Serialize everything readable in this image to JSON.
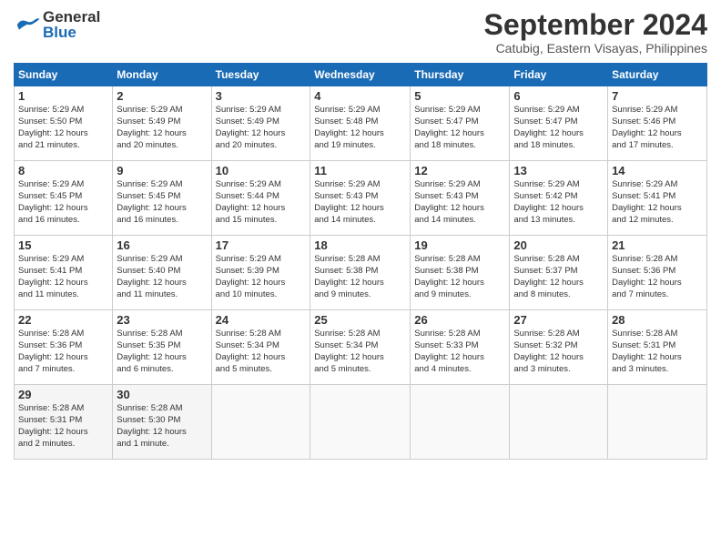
{
  "header": {
    "logo_line1": "General",
    "logo_line2": "Blue",
    "month": "September 2024",
    "location": "Catubig, Eastern Visayas, Philippines"
  },
  "weekdays": [
    "Sunday",
    "Monday",
    "Tuesday",
    "Wednesday",
    "Thursday",
    "Friday",
    "Saturday"
  ],
  "weeks": [
    [
      {
        "day": "1",
        "info": "Sunrise: 5:29 AM\nSunset: 5:50 PM\nDaylight: 12 hours\nand 21 minutes."
      },
      {
        "day": "2",
        "info": "Sunrise: 5:29 AM\nSunset: 5:49 PM\nDaylight: 12 hours\nand 20 minutes."
      },
      {
        "day": "3",
        "info": "Sunrise: 5:29 AM\nSunset: 5:49 PM\nDaylight: 12 hours\nand 20 minutes."
      },
      {
        "day": "4",
        "info": "Sunrise: 5:29 AM\nSunset: 5:48 PM\nDaylight: 12 hours\nand 19 minutes."
      },
      {
        "day": "5",
        "info": "Sunrise: 5:29 AM\nSunset: 5:47 PM\nDaylight: 12 hours\nand 18 minutes."
      },
      {
        "day": "6",
        "info": "Sunrise: 5:29 AM\nSunset: 5:47 PM\nDaylight: 12 hours\nand 18 minutes."
      },
      {
        "day": "7",
        "info": "Sunrise: 5:29 AM\nSunset: 5:46 PM\nDaylight: 12 hours\nand 17 minutes."
      }
    ],
    [
      {
        "day": "8",
        "info": "Sunrise: 5:29 AM\nSunset: 5:45 PM\nDaylight: 12 hours\nand 16 minutes."
      },
      {
        "day": "9",
        "info": "Sunrise: 5:29 AM\nSunset: 5:45 PM\nDaylight: 12 hours\nand 16 minutes."
      },
      {
        "day": "10",
        "info": "Sunrise: 5:29 AM\nSunset: 5:44 PM\nDaylight: 12 hours\nand 15 minutes."
      },
      {
        "day": "11",
        "info": "Sunrise: 5:29 AM\nSunset: 5:43 PM\nDaylight: 12 hours\nand 14 minutes."
      },
      {
        "day": "12",
        "info": "Sunrise: 5:29 AM\nSunset: 5:43 PM\nDaylight: 12 hours\nand 14 minutes."
      },
      {
        "day": "13",
        "info": "Sunrise: 5:29 AM\nSunset: 5:42 PM\nDaylight: 12 hours\nand 13 minutes."
      },
      {
        "day": "14",
        "info": "Sunrise: 5:29 AM\nSunset: 5:41 PM\nDaylight: 12 hours\nand 12 minutes."
      }
    ],
    [
      {
        "day": "15",
        "info": "Sunrise: 5:29 AM\nSunset: 5:41 PM\nDaylight: 12 hours\nand 11 minutes."
      },
      {
        "day": "16",
        "info": "Sunrise: 5:29 AM\nSunset: 5:40 PM\nDaylight: 12 hours\nand 11 minutes."
      },
      {
        "day": "17",
        "info": "Sunrise: 5:29 AM\nSunset: 5:39 PM\nDaylight: 12 hours\nand 10 minutes."
      },
      {
        "day": "18",
        "info": "Sunrise: 5:28 AM\nSunset: 5:38 PM\nDaylight: 12 hours\nand 9 minutes."
      },
      {
        "day": "19",
        "info": "Sunrise: 5:28 AM\nSunset: 5:38 PM\nDaylight: 12 hours\nand 9 minutes."
      },
      {
        "day": "20",
        "info": "Sunrise: 5:28 AM\nSunset: 5:37 PM\nDaylight: 12 hours\nand 8 minutes."
      },
      {
        "day": "21",
        "info": "Sunrise: 5:28 AM\nSunset: 5:36 PM\nDaylight: 12 hours\nand 7 minutes."
      }
    ],
    [
      {
        "day": "22",
        "info": "Sunrise: 5:28 AM\nSunset: 5:36 PM\nDaylight: 12 hours\nand 7 minutes."
      },
      {
        "day": "23",
        "info": "Sunrise: 5:28 AM\nSunset: 5:35 PM\nDaylight: 12 hours\nand 6 minutes."
      },
      {
        "day": "24",
        "info": "Sunrise: 5:28 AM\nSunset: 5:34 PM\nDaylight: 12 hours\nand 5 minutes."
      },
      {
        "day": "25",
        "info": "Sunrise: 5:28 AM\nSunset: 5:34 PM\nDaylight: 12 hours\nand 5 minutes."
      },
      {
        "day": "26",
        "info": "Sunrise: 5:28 AM\nSunset: 5:33 PM\nDaylight: 12 hours\nand 4 minutes."
      },
      {
        "day": "27",
        "info": "Sunrise: 5:28 AM\nSunset: 5:32 PM\nDaylight: 12 hours\nand 3 minutes."
      },
      {
        "day": "28",
        "info": "Sunrise: 5:28 AM\nSunset: 5:31 PM\nDaylight: 12 hours\nand 3 minutes."
      }
    ],
    [
      {
        "day": "29",
        "info": "Sunrise: 5:28 AM\nSunset: 5:31 PM\nDaylight: 12 hours\nand 2 minutes."
      },
      {
        "day": "30",
        "info": "Sunrise: 5:28 AM\nSunset: 5:30 PM\nDaylight: 12 hours\nand 1 minute."
      },
      {
        "day": "",
        "info": ""
      },
      {
        "day": "",
        "info": ""
      },
      {
        "day": "",
        "info": ""
      },
      {
        "day": "",
        "info": ""
      },
      {
        "day": "",
        "info": ""
      }
    ]
  ]
}
